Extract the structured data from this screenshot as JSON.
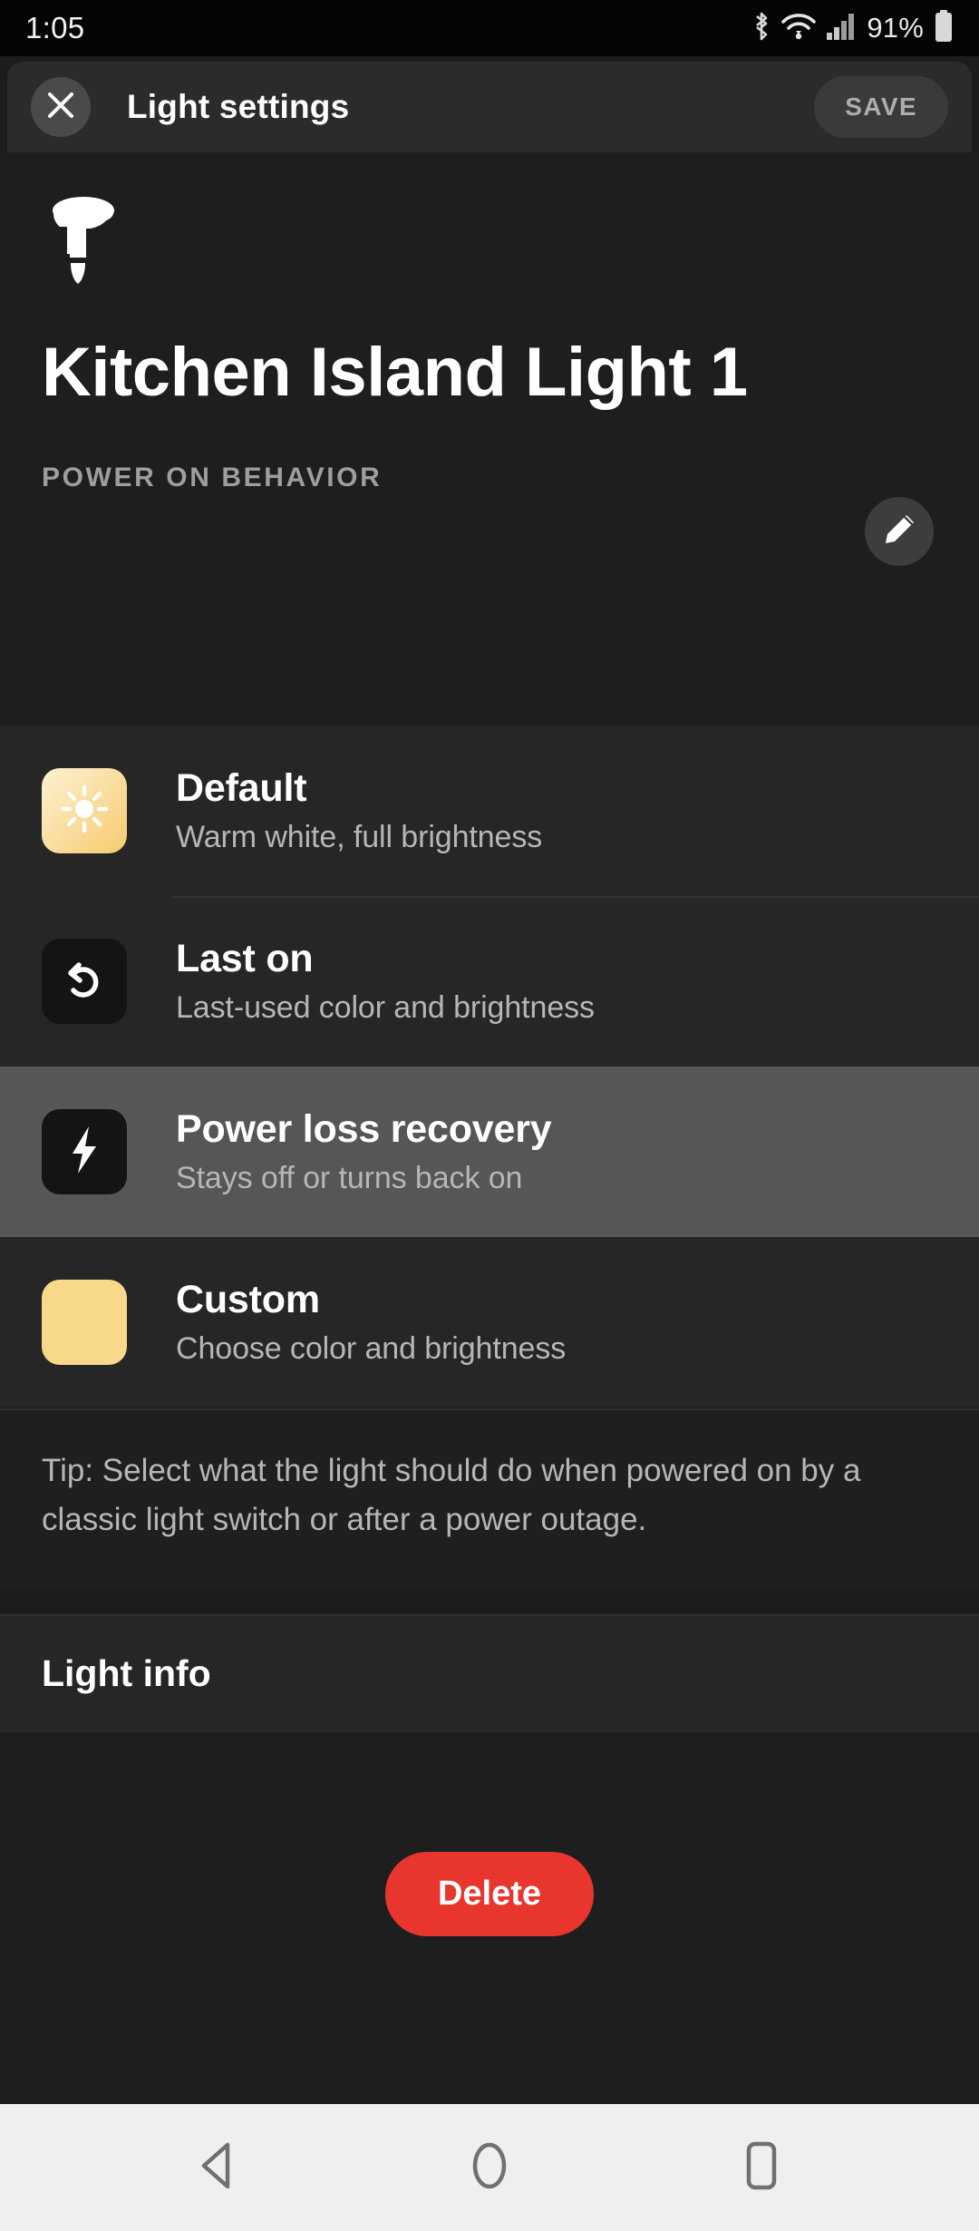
{
  "status_bar": {
    "time": "1:05",
    "battery_percent": "91%",
    "icons": [
      "bluetooth-icon",
      "wifi-icon",
      "cellular-signal-icon",
      "battery-icon"
    ]
  },
  "app_bar": {
    "close_icon": "close-icon",
    "title": "Light settings",
    "save_label": "SAVE",
    "save_enabled": false
  },
  "hero": {
    "device_icon": "spotlight-bulb-icon",
    "device_name": "Kitchen Island Light 1",
    "edit_icon": "pencil-icon"
  },
  "power_on_behavior": {
    "section_label": "POWER ON BEHAVIOR",
    "options": [
      {
        "title": "Default",
        "subtitle": "Warm white, full brightness",
        "icon": "sun-icon",
        "tile_style": "gradient-warm",
        "tile_color": "#f6cb6e",
        "selected": false
      },
      {
        "title": "Last on",
        "subtitle": "Last-used color and brightness",
        "icon": "undo-arrow-icon",
        "tile_style": "dark",
        "tile_color": "#141414",
        "selected": false
      },
      {
        "title": "Power loss recovery",
        "subtitle": "Stays off or turns back on",
        "icon": "lightning-bolt-icon",
        "tile_style": "dark",
        "tile_color": "#141414",
        "selected": true
      },
      {
        "title": "Custom",
        "subtitle": "Choose color and brightness",
        "icon": "color-swatch-icon",
        "tile_style": "solid",
        "tile_color": "#f8d98c",
        "selected": false
      }
    ],
    "tip": "Tip: Select what the light should do when powered on by a classic light switch or after a power outage."
  },
  "light_info": {
    "label": "Light info"
  },
  "footer": {
    "delete_label": "Delete",
    "delete_color": "#e8362f"
  },
  "nav_bar": {
    "back_icon": "back-triangle-icon",
    "home_icon": "home-circle-icon",
    "recents_icon": "recents-square-icon"
  }
}
